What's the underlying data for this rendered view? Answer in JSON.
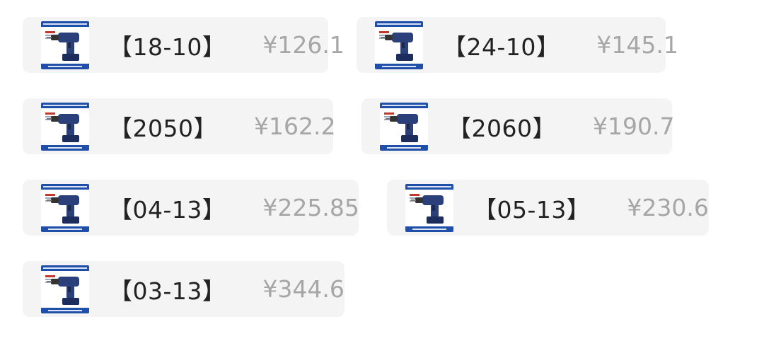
{
  "options": [
    {
      "spec": "【18-10】",
      "price": "¥126.1",
      "thumb_icon": "drill-product-icon"
    },
    {
      "spec": "【24-10】",
      "price": "¥145.1",
      "thumb_icon": "drill-product-icon"
    },
    {
      "spec": "【2050】",
      "price": "¥162.2",
      "thumb_icon": "drill-product-icon"
    },
    {
      "spec": "【2060】",
      "price": "¥190.7",
      "thumb_icon": "drill-product-icon"
    },
    {
      "spec": "【04-13】",
      "price": "¥225.85",
      "thumb_icon": "drill-product-icon"
    },
    {
      "spec": "【05-13】",
      "price": "¥230.6",
      "thumb_icon": "drill-product-icon"
    },
    {
      "spec": "【03-13】",
      "price": "¥344.6",
      "thumb_icon": "drill-product-icon"
    }
  ],
  "colors": {
    "chip_bg": "#f4f4f4",
    "spec_text": "#222222",
    "price_text": "#a6a6a6",
    "thumb_banner": "#1f4fa8",
    "drill_body": "#2b3f7a"
  }
}
